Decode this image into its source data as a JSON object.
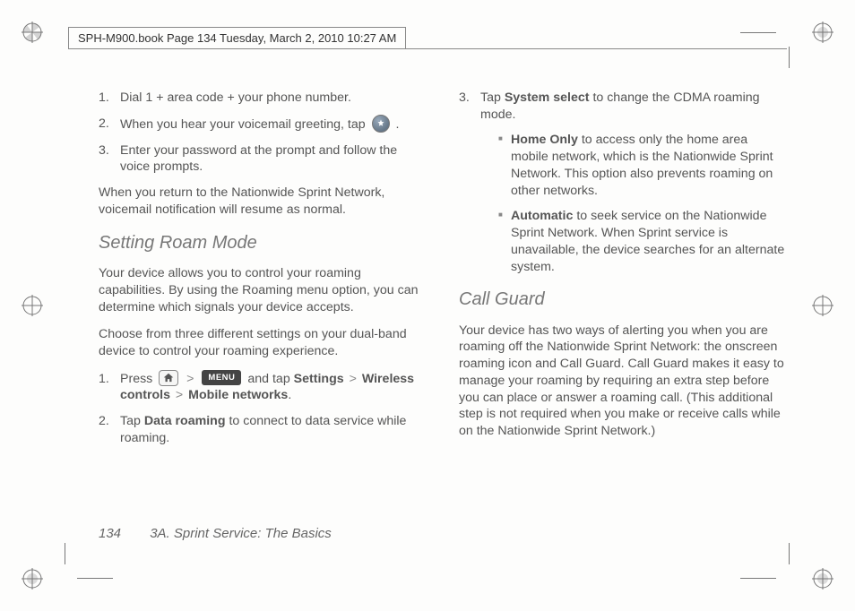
{
  "header": {
    "stamp": "SPH-M900.book  Page 134  Tuesday, March 2, 2010  10:27 AM"
  },
  "icons": {
    "menu_label": "MENU"
  },
  "left": {
    "list1": {
      "i1": "Dial 1 + area code + your phone number.",
      "i2_a": "When you hear your voicemail greeting, tap ",
      "i2_b": " .",
      "i3": "Enter your password at the prompt and follow the voice prompts."
    },
    "para1": "When you return to the Nationwide Sprint Network, voicemail notification will resume as normal.",
    "heading1": "Setting Roam Mode",
    "para2": "Your device allows you to control your roaming capabilities. By using the Roaming menu option, you can determine which signals your device accepts.",
    "para3": "Choose from three different settings on your dual-band device to control your roaming experience.",
    "list2": {
      "i1_a": "Press ",
      "i1_b": " and tap ",
      "i1_settings": "Settings",
      "i1_wireless": "Wireless controls",
      "i1_mobile": "Mobile networks",
      "i1_end": ".",
      "i2_a": "Tap ",
      "i2_bold": "Data roaming",
      "i2_b": " to connect to data service while roaming."
    }
  },
  "right": {
    "list1": {
      "i3_a": "Tap ",
      "i3_bold": "System select",
      "i3_b": " to change the CDMA roaming mode.",
      "b1_bold": "Home Only",
      "b1_text": " to access only the home area mobile network, which is the Nationwide Sprint Network. This option also prevents roaming on other networks.",
      "b2_bold": "Automatic",
      "b2_text": " to seek service on the Nationwide Sprint Network. When Sprint service is unavailable, the device searches for an alternate system."
    },
    "heading1": "Call Guard",
    "para1": "Your device has two ways of alerting you when you are roaming off the Nationwide Sprint Network: the onscreen roaming icon and Call Guard. Call Guard makes it easy to manage your roaming by requiring an extra step before you can place or answer a roaming call. (This additional step is not required when you make or receive calls while on the Nationwide Sprint Network.)"
  },
  "footer": {
    "page": "134",
    "section": "3A. Sprint Service: The Basics"
  },
  "gt": ">"
}
